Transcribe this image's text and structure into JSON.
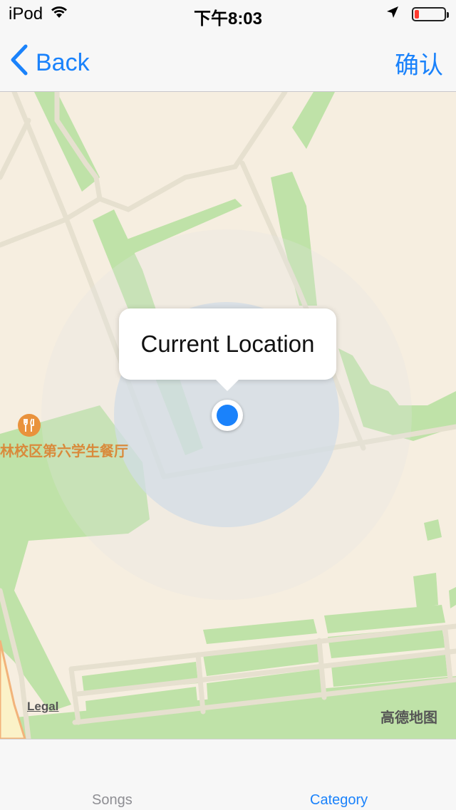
{
  "status_bar": {
    "carrier": "iPod",
    "time": "下午8:03",
    "battery_level": 0.15,
    "icons": [
      "wifi-icon",
      "location-arrow-icon",
      "battery-icon"
    ]
  },
  "nav": {
    "back_label": "Back",
    "confirm_label": "确认"
  },
  "map": {
    "poi_label": "林校区第六学生餐厅",
    "poi_icon": "restaurant-icon",
    "callout_title": "Current Location",
    "legal_label": "Legal",
    "attribution": "高德地图"
  },
  "tabs": [
    {
      "label": "Songs",
      "selected": false
    },
    {
      "label": "Category",
      "selected": true
    }
  ],
  "colors": {
    "accent": "#1a82fb",
    "map_background": "#f6eee0",
    "map_green": "#bfe2a8",
    "road": "#e6e0cf",
    "poi": "#e9923c",
    "battery_low": "#ff3b30"
  }
}
